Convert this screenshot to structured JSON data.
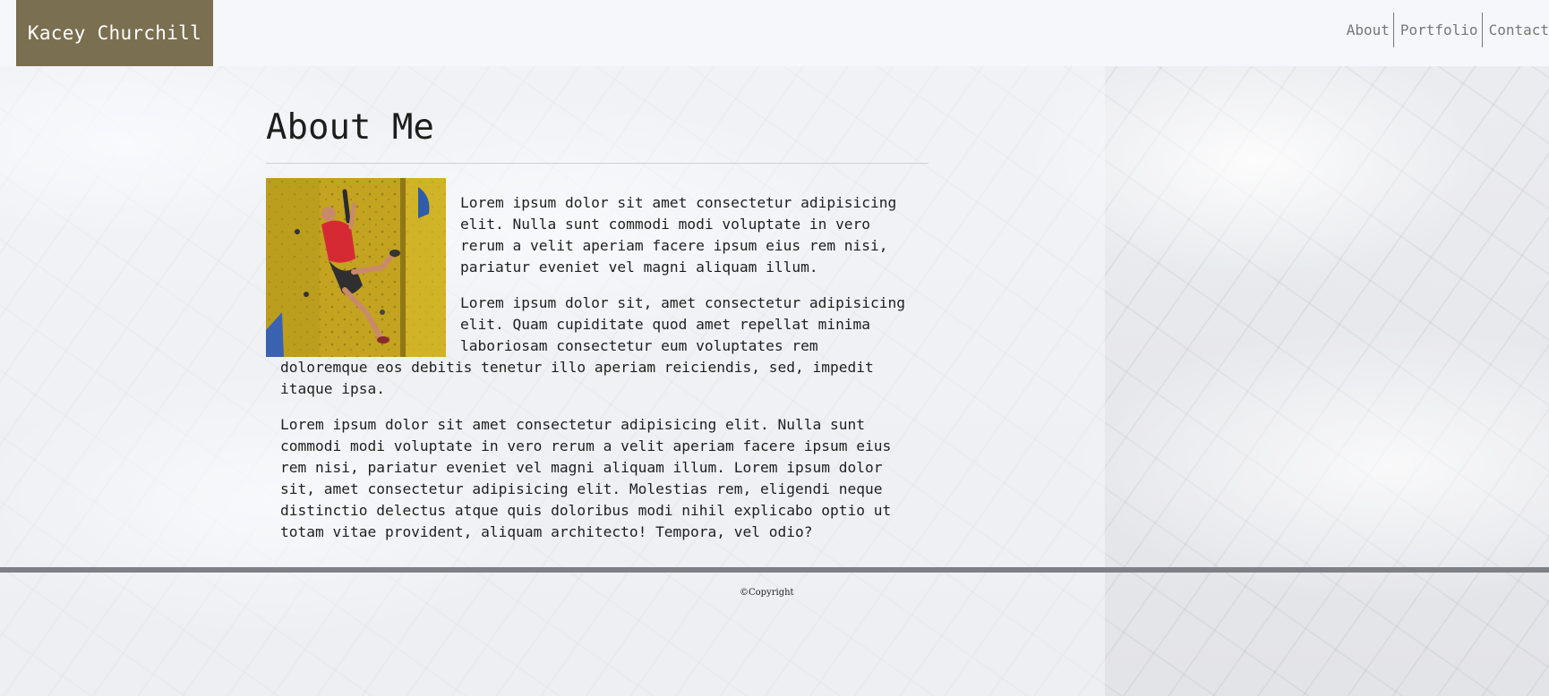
{
  "header": {
    "brand": "Kacey Churchill",
    "nav": [
      "About",
      "Portfolio",
      "Contact"
    ]
  },
  "main": {
    "title": "About Me",
    "photo_alt": "rock-climber-photo",
    "paragraphs": [
      "Lorem ipsum dolor sit amet consectetur adipisicing elit. Nulla sunt commodi modi voluptate in vero rerum a velit aperiam facere ipsum eius rem nisi, pariatur eveniet vel magni aliquam illum.",
      "Lorem ipsum dolor sit, amet consectetur adipisicing elit. Quam cupiditate quod amet repellat minima laboriosam consectetur eum voluptates rem doloremque eos debitis tenetur illo aperiam reiciendis, sed, impedit itaque ipsa.",
      "Lorem ipsum dolor sit amet consectetur adipisicing elit. Nulla sunt commodi modi voluptate in vero rerum a velit aperiam facere ipsum eius rem nisi, pariatur eveniet vel magni aliquam illum. Lorem ipsum dolor sit, amet consectetur adipisicing elit. Molestias rem, eligendi neque distinctio delectus atque quis doloribus modi nihil explicabo optio ut totam vitae provident, aliquam architecto! Tempora, vel odio?"
    ]
  },
  "footer": {
    "copyright": "©Copyright"
  },
  "colors": {
    "brand_bg": "#7a6f51",
    "header_bg": "#f6f7fb",
    "footer_bar": "#7f7f86"
  }
}
